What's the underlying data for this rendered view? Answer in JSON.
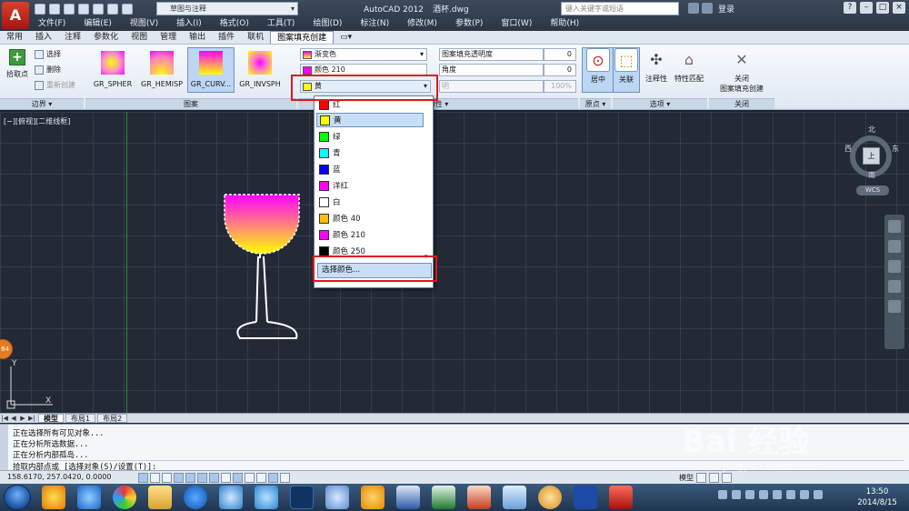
{
  "title": {
    "app": "AutoCAD 2012",
    "file": "酒杯.dwg"
  },
  "workspace": "草图与注释",
  "search": {
    "placeholder": "键入关键字或短语"
  },
  "login": "登录",
  "menu": [
    "文件(F)",
    "编辑(E)",
    "视图(V)",
    "插入(I)",
    "格式(O)",
    "工具(T)",
    "绘图(D)",
    "标注(N)",
    "修改(M)",
    "参数(P)",
    "窗口(W)",
    "帮助(H)"
  ],
  "ribbon_tabs": [
    "常用",
    "插入",
    "注释",
    "参数化",
    "视图",
    "管理",
    "输出",
    "插件",
    "联机",
    "图案填充创建"
  ],
  "ribbon_tab_extra": "▭▾",
  "boundary_panel": {
    "pick_label": "拾取点",
    "select_label": "选择",
    "delete_label": "删除",
    "recreate_label": "重新创建",
    "title": "边界 ▾"
  },
  "pattern_panel": {
    "title": "图案",
    "swatches": [
      {
        "label": "GR_SPHER"
      },
      {
        "label": "GR_HEMISP"
      },
      {
        "label": "GR_CURV..."
      },
      {
        "label": "GR_INVSPH"
      }
    ]
  },
  "properties": {
    "type_value": "渐变色",
    "color1_value": "颜色 210",
    "color2_value": "黄",
    "transparency_label": "图案填充透明度",
    "transparency_value": "0",
    "angle_label": "角度",
    "angle_value": "0",
    "shade_label": "明",
    "shade_value": "100%",
    "title": "特性 ▾"
  },
  "origin_panel": {
    "center_label": "居中",
    "title": "原点 ▾"
  },
  "options_panel": {
    "associative_label": "关联",
    "annotative_label": "注释性",
    "match_label": "特性匹配",
    "title": "选项 ▾"
  },
  "close_panel": {
    "close_label": "关闭",
    "close_sub": "图案填充创建",
    "title": "关闭"
  },
  "viewport": {
    "label": "[−][俯视][二维线框]"
  },
  "viewcube": {
    "north": "北",
    "south": "南",
    "east": "东",
    "west": "西",
    "top": "上",
    "wcs": "WCS"
  },
  "ucs": {
    "y": "Y",
    "x": "X",
    "badge": "64"
  },
  "color_dropdown": {
    "items": [
      {
        "label": "红",
        "color": "#ff0000"
      },
      {
        "label": "黄",
        "color": "#ffff00",
        "selected": true
      },
      {
        "label": "绿",
        "color": "#00ff00"
      },
      {
        "label": "青",
        "color": "#00ffff"
      },
      {
        "label": "蓝",
        "color": "#0000ff"
      },
      {
        "label": "洋红",
        "color": "#ff00ff"
      },
      {
        "label": "白",
        "color": "#ffffff"
      },
      {
        "label": "颜色 40",
        "color": "#ffbf00"
      },
      {
        "label": "颜色 210",
        "color": "#ff00ff"
      },
      {
        "label": "颜色 250",
        "color": "#000000"
      }
    ],
    "select_more": "选择颜色..."
  },
  "layout_tabs": {
    "model": "模型",
    "layout1": "布局1",
    "layout2": "布局2"
  },
  "command_lines": [
    "正在选择所有可见对象...",
    "正在分析所选数据...",
    "正在分析内部孤岛...",
    "拾取内部点或 [选择对象(S)/设置(T)]:"
  ],
  "status": {
    "coords": "158.6170,  257.0420,  0.0000",
    "model": "模型"
  },
  "taskbar": {
    "time": "13:50",
    "date": "2014/8/15"
  },
  "watermark": {
    "brand": "Bai  经验",
    "url": "jingyan.baidu.com"
  },
  "colors": {
    "accent": "#e0161d",
    "grid_bg": "#232a35",
    "selection": "#c8ddf6"
  }
}
